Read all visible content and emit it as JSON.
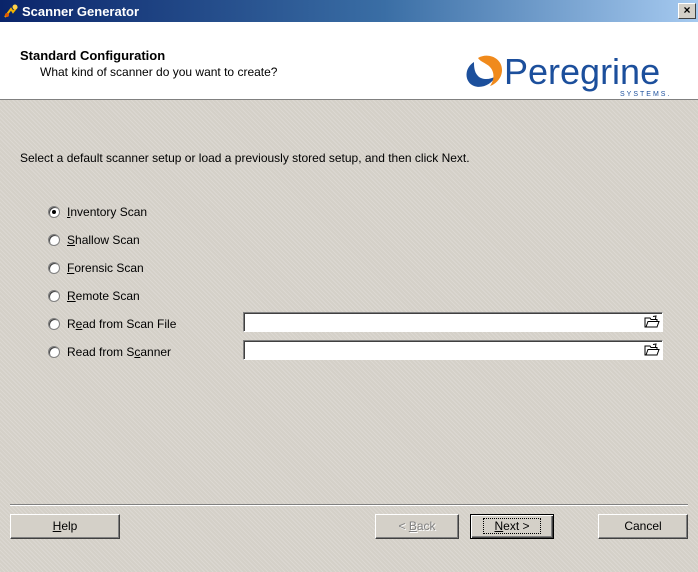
{
  "window": {
    "title": "Scanner Generator",
    "close_label": "×"
  },
  "header": {
    "title": "Standard Configuration",
    "subtitle": "What kind of scanner do you want to create?",
    "logo_text": "Peregrine",
    "logo_subtext": "SYSTEMS."
  },
  "instruction": "Select a default scanner setup or load a previously stored setup, and then click Next.",
  "options": [
    {
      "pre": "",
      "mnemonic": "I",
      "post": "nventory Scan",
      "checked": true
    },
    {
      "pre": "",
      "mnemonic": "S",
      "post": "hallow Scan",
      "checked": false
    },
    {
      "pre": "",
      "mnemonic": "F",
      "post": "orensic Scan",
      "checked": false
    },
    {
      "pre": "",
      "mnemonic": "R",
      "post": "emote Scan",
      "checked": false
    },
    {
      "pre": "R",
      "mnemonic": "e",
      "post": "ad from Scan File",
      "checked": false
    },
    {
      "pre": "Read from S",
      "mnemonic": "c",
      "post": "anner",
      "checked": false
    }
  ],
  "fields": {
    "scan_file_value": "",
    "scanner_value": ""
  },
  "buttons": {
    "help": {
      "mnemonic": "H",
      "rest": "elp"
    },
    "back": {
      "pre": "< ",
      "mnemonic": "B",
      "rest": "ack"
    },
    "next": {
      "mnemonic": "N",
      "rest": "ext >"
    },
    "cancel": "Cancel"
  },
  "icons": {
    "app": "scanner-generator-icon",
    "browse": "open-folder-icon"
  },
  "colors": {
    "titlebar_start": "#0a246a",
    "titlebar_end": "#a6caf0",
    "logo_blue": "#1c4f9c",
    "logo_orange": "#f08a1c"
  }
}
